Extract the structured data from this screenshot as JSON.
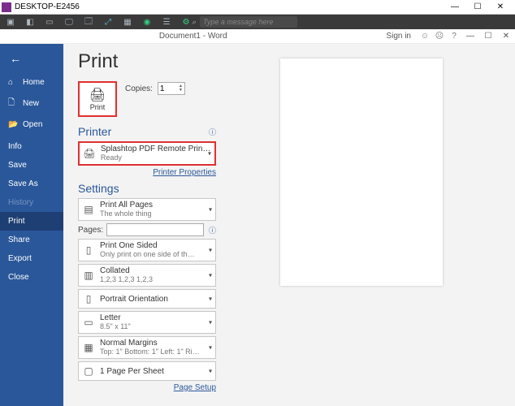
{
  "window": {
    "title": "DESKTOP-E2456",
    "min": "—",
    "max": "☐",
    "close": "✕"
  },
  "remote_toolbar": {
    "message_placeholder": "Type a message here"
  },
  "docbar": {
    "title": "Document1 - Word",
    "signin": "Sign in",
    "min": "—",
    "max": "☐",
    "close": "✕",
    "help": "?"
  },
  "sidebar": {
    "back": "←",
    "items": [
      {
        "icon": "⌂",
        "label": "Home"
      },
      {
        "icon": "🗋",
        "label": "New"
      },
      {
        "icon": "📂",
        "label": "Open"
      },
      {
        "icon": "",
        "label": "Info"
      },
      {
        "icon": "",
        "label": "Save"
      },
      {
        "icon": "",
        "label": "Save As"
      },
      {
        "icon": "",
        "label": "History"
      },
      {
        "icon": "",
        "label": "Print"
      },
      {
        "icon": "",
        "label": "Share"
      },
      {
        "icon": "",
        "label": "Export"
      },
      {
        "icon": "",
        "label": "Close"
      }
    ]
  },
  "print": {
    "heading": "Print",
    "button_label": "Print",
    "copies_label": "Copies:",
    "copies_value": "1",
    "printer_heading": "Printer",
    "printer_name": "Splashtop PDF Remote Printer",
    "printer_status": "Ready",
    "printer_properties": "Printer Properties",
    "settings_heading": "Settings",
    "pages_label": "Pages:",
    "page_setup": "Page Setup",
    "options": [
      {
        "line1": "Print All Pages",
        "line2": "The whole thing"
      },
      {
        "line1": "Print One Sided",
        "line2": "Only print on one side of th…"
      },
      {
        "line1": "Collated",
        "line2": "1,2,3   1,2,3   1,2,3"
      },
      {
        "line1": "Portrait Orientation",
        "line2": ""
      },
      {
        "line1": "Letter",
        "line2": "8.5\" x 11\""
      },
      {
        "line1": "Normal Margins",
        "line2": "Top: 1\" Bottom: 1\" Left: 1\" Ri…"
      },
      {
        "line1": "1 Page Per Sheet",
        "line2": ""
      }
    ]
  }
}
